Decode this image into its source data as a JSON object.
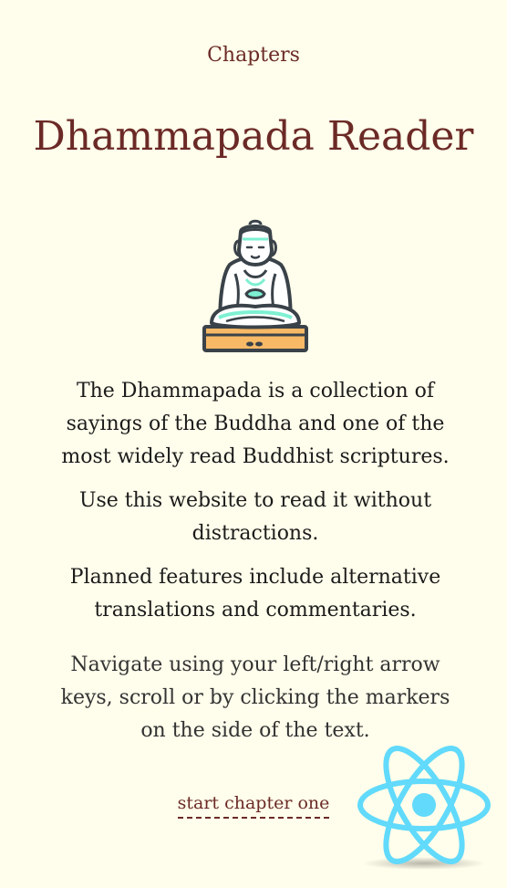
{
  "nav": {
    "chapters_label": "Chapters"
  },
  "header": {
    "title": "Dhammapada Reader"
  },
  "intro": {
    "paragraph1": "The Dhammapada is a collection of sayings of the Buddha and one of the most widely read Buddhist scriptures.",
    "paragraph2": "Use this website to read it without distractions.",
    "paragraph3": "Planned features include alternative translations and commentaries.",
    "paragraph4": "Navigate using your left/right arrow keys, scroll or by clicking the markers on the side of the text."
  },
  "cta": {
    "start_label": "start chapter one"
  },
  "icons": {
    "buddha": "buddha-statue-icon",
    "react": "react-logo-icon"
  },
  "colors": {
    "background": "#fffdeb",
    "accent": "#6b2a26",
    "react": "#61dafb",
    "buddha_teal": "#7ef0d2",
    "buddha_base": "#f7b966",
    "outline": "#3a4249"
  }
}
